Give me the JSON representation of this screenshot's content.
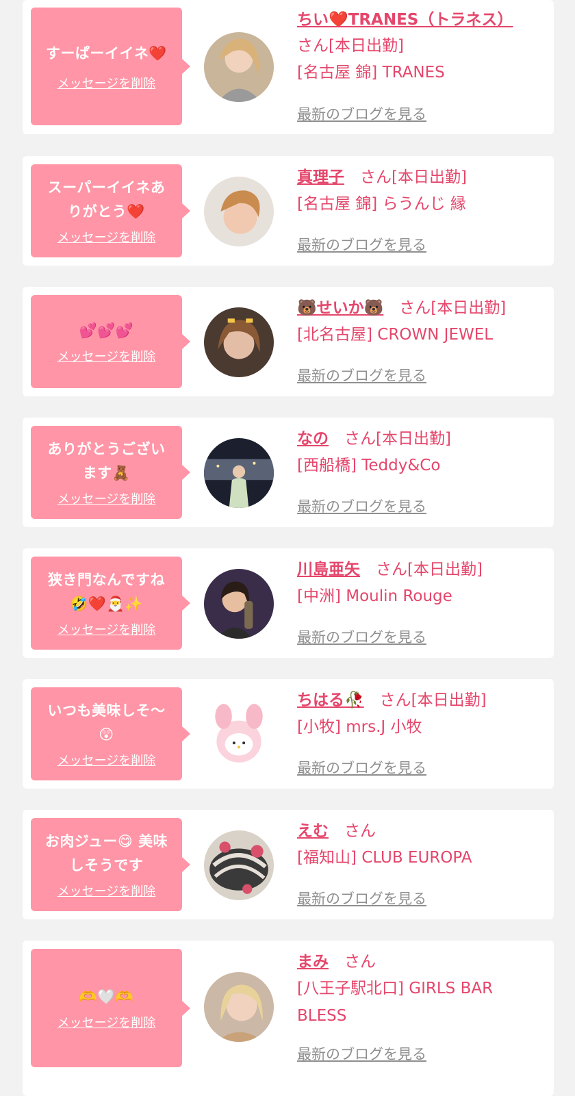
{
  "delete_label": "メッセージを削除",
  "blog_label": "最新のブログを見る",
  "colors": {
    "accent": "#e5466b",
    "bubble": "#ff95a6",
    "background": "#f2f2f2",
    "link_gray": "#8f8f8f"
  },
  "items": [
    {
      "message": "すーぱーイイネ❤️",
      "name": "ちい❤️TRANES（トラネス）",
      "suffix": "さん[本日出勤]",
      "shop": "[名古屋 錦] TRANES"
    },
    {
      "message": "スーパーイイネあ\nりがとう❤️",
      "name": "真理子",
      "suffix": "さん[本日出勤]",
      "shop": "[名古屋 錦] らうんじ 縁"
    },
    {
      "message": "💕💕💕",
      "name": "🐻せいか🐻",
      "suffix": "さん[本日出勤]",
      "shop": "[北名古屋] CROWN JEWEL"
    },
    {
      "message": "ありがとうござい\nます🧸",
      "name": "なの",
      "suffix": "さん[本日出勤]",
      "shop": "[西船橋] Teddy&Co"
    },
    {
      "message": "狭き門なんですね\n🤣❤️🎅✨",
      "name": "川島亜矢",
      "suffix": "さん[本日出勤]",
      "shop": "[中洲] Moulin Rouge"
    },
    {
      "message": "いつも美味しそ〜\n😲",
      "name": "ちはる🥀",
      "suffix": "さん[本日出勤]",
      "shop": "[小牧] mrs.J 小牧"
    },
    {
      "message": "お肉ジュー😋 美味\nしそうです",
      "name": "えむ",
      "suffix": "さん",
      "shop": "[福知山] CLUB EUROPA"
    },
    {
      "message": "🫶🤍🫶",
      "name": "まみ",
      "suffix": "さん",
      "shop": "[八王子駅北口] GIRLS BAR\nBLESS"
    }
  ]
}
